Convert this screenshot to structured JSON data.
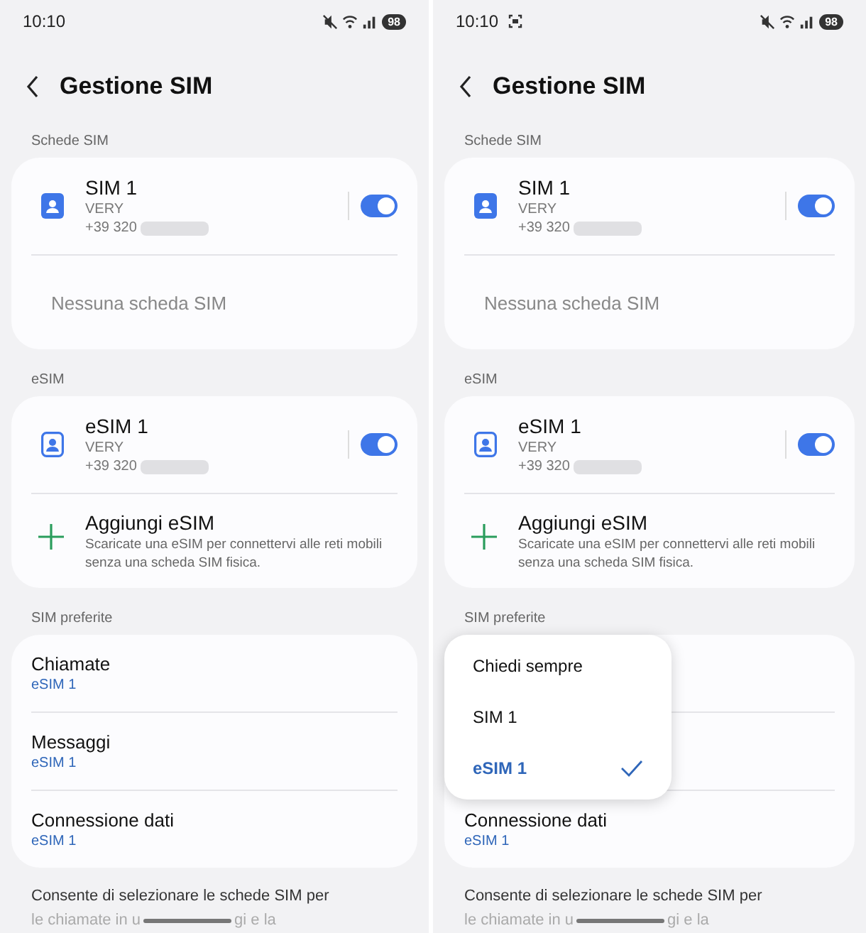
{
  "screens": [
    {
      "status_bar": {
        "time": "10:10",
        "screen_record": false,
        "battery": "98"
      },
      "title": "Gestione SIM",
      "sim_section": {
        "label": "Schede SIM",
        "cards": [
          {
            "kind": "sim",
            "name": "SIM 1",
            "carrier": "VERY",
            "number": "+39 320",
            "enabled": true
          },
          {
            "kind": "empty",
            "name": "Nessuna scheda SIM"
          }
        ]
      },
      "esim_section": {
        "label": "eSIM",
        "cards": [
          {
            "kind": "esim",
            "name": "eSIM 1",
            "carrier": "VERY",
            "number": "+39 320",
            "enabled": true
          },
          {
            "kind": "add",
            "name": "Aggiungi eSIM",
            "description": "Scaricate una eSIM per connettervi alle reti mobili senza una scheda SIM fisica."
          }
        ]
      },
      "preferred_section": {
        "label": "SIM preferite",
        "rows": [
          {
            "kind": "row",
            "label": "Chiamate",
            "value": "eSIM 1"
          },
          {
            "kind": "row",
            "label": "Messaggi",
            "value": "eSIM 1"
          },
          {
            "kind": "row",
            "label": "Connessione dati",
            "value": "eSIM 1"
          }
        ]
      },
      "footer": [
        "Consente di selezionare le schede SIM per",
        "le chiamate in u",
        "gi e la"
      ]
    },
    {
      "status_bar": {
        "time": "10:10",
        "screen_record": true,
        "battery": "98"
      },
      "title": "Gestione SIM",
      "sim_section": {
        "label": "Schede SIM",
        "cards": [
          {
            "kind": "sim",
            "name": "SIM 1",
            "carrier": "VERY",
            "number": "+39 320",
            "enabled": true
          },
          {
            "kind": "empty",
            "name": "Nessuna scheda SIM"
          }
        ]
      },
      "esim_section": {
        "label": "eSIM",
        "cards": [
          {
            "kind": "esim",
            "name": "eSIM 1",
            "carrier": "VERY",
            "number": "+39 320",
            "enabled": true
          },
          {
            "kind": "add",
            "name": "Aggiungi eSIM",
            "description": "Scaricate una eSIM per connettervi alle reti mobili senza una scheda SIM fisica."
          }
        ]
      },
      "preferred_section": {
        "label": "SIM preferite",
        "rows": [
          {
            "kind": "covered"
          },
          {
            "kind": "covered"
          },
          {
            "kind": "row",
            "label": "Connessione dati",
            "value": "eSIM 1"
          }
        ],
        "popup": [
          {
            "label": "Chiedi sempre",
            "selected": false
          },
          {
            "label": "SIM 1",
            "selected": false
          },
          {
            "label": "eSIM 1",
            "selected": true
          }
        ]
      },
      "footer": [
        "Consente di selezionare le schede SIM per",
        "le chiamate in u",
        "gi e la"
      ]
    }
  ]
}
